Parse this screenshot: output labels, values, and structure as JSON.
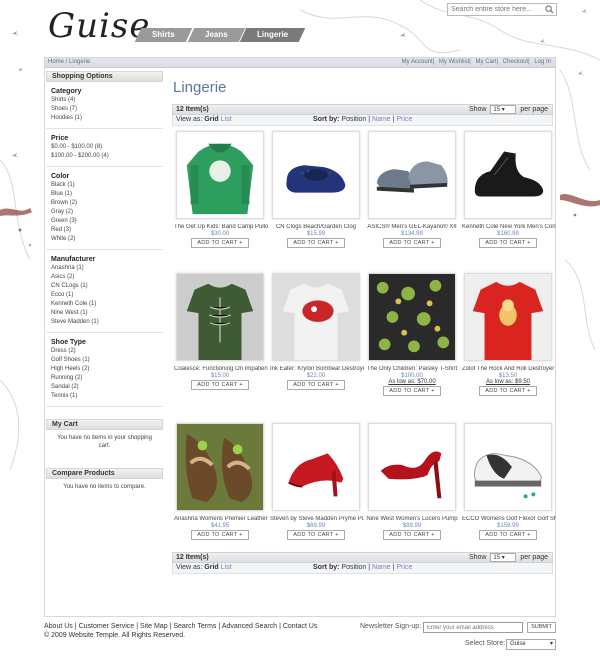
{
  "brand": {
    "logo": "Guise"
  },
  "search": {
    "placeholder": "Search entire store here..."
  },
  "nav": {
    "tabs": [
      {
        "label": "Shirts"
      },
      {
        "label": "Jeans"
      },
      {
        "label": "Lingerie"
      }
    ]
  },
  "breadcrumb": {
    "home": "Home",
    "sep": " / ",
    "current": "Lingerie"
  },
  "toplinks": [
    "My Account",
    "My Wishlist",
    "My Cart",
    "Checkout",
    "Log In"
  ],
  "sidebar": {
    "title": "Shopping Options",
    "filters": [
      {
        "name": "Category",
        "items": [
          "Shirts (4)",
          "Shoes (7)",
          "Hoodies (1)"
        ]
      },
      {
        "name": "Price",
        "items": [
          "$0.00 - $100.00 (8)",
          "$100.00 - $200.00 (4)"
        ]
      },
      {
        "name": "Color",
        "items": [
          "Black (1)",
          "Blue (1)",
          "Brown (2)",
          "Gray (2)",
          "Green (3)",
          "Red (3)",
          "White (2)"
        ]
      },
      {
        "name": "Manufacturer",
        "items": [
          "Anashria (1)",
          "Asics (2)",
          "CN CLogs (1)",
          "Ecco (1)",
          "Kenneth Cole (1)",
          "Nine West (1)",
          "Steve Madden (1)"
        ]
      },
      {
        "name": "Shoe Type",
        "items": [
          "Dress (2)",
          "Golf Shoes (1)",
          "High Heels (2)",
          "Running (2)",
          "Sandal (2)",
          "Tennis (1)"
        ]
      }
    ],
    "cart": {
      "title": "My Cart",
      "message": "You have no items in your shopping cart."
    },
    "compare": {
      "title": "Compare Products",
      "message": "You have no items to compare."
    }
  },
  "main": {
    "title": "Lingerie",
    "count": "12 Item(s)",
    "show_label": "Show",
    "per_page": "15",
    "per_page_label": "per page",
    "view_as": "View as:",
    "view_grid": "Grid",
    "view_list": "List",
    "sort_by": "Sort by:",
    "sort_position": "Position",
    "sort_name": "Name",
    "sort_price": "Price",
    "add_to_cart": "ADD TO CART +",
    "products": [
      {
        "name": "The Get Up Kids: Band Camp Pullover",
        "price": "$30.00"
      },
      {
        "name": "CN Clogs Beach/Garden Clog",
        "price": "$15.99"
      },
      {
        "name": "ASICS® Men's GEL-Kayano® XII",
        "price": "$134.99"
      },
      {
        "name": "Kenneth Cole New York Men's Con",
        "price": "$160.99"
      },
      {
        "name": "Coalesce: Functioning On Impatience",
        "price": "$15.00"
      },
      {
        "name": "Ink Eater: Krylon Bombear Destroyed",
        "price": "$22.00"
      },
      {
        "name": "The Only Children: Paisley T-Shirt",
        "price": "$100.00",
        "as_low": "As low as: $70.00"
      },
      {
        "name": "Zolof The Rock And Roll Destroyer",
        "price": "$13.50",
        "as_low": "As low as: $9.50"
      },
      {
        "name": "Anashria Womens Premier Leather",
        "price": "$41.95"
      },
      {
        "name": "Steven by Steve Madden Pryme Pump",
        "price": "$69.99"
      },
      {
        "name": "Nine West Women's Lucero Pump",
        "price": "$89.99"
      },
      {
        "name": "ECCO Womens Golf Flexor Golf Shoe",
        "price": "$159.99"
      }
    ]
  },
  "footer": {
    "links": [
      "About Us",
      "Customer Service",
      "Site Map",
      "Search Terms",
      "Advanced Search",
      "Contact Us"
    ],
    "copyright": "© 2009 Website Temple. All Rights Reserved.",
    "newsletter_label": "Newsletter Sign-up:",
    "newsletter_placeholder": "Enter your email address",
    "subscribe": "SUBMIT",
    "store_label": "Select Store:",
    "store_value": "Guise"
  },
  "colors": {
    "accent": "#5a78a4",
    "link": "#6b87b6",
    "tab": "#9a9a9a"
  }
}
